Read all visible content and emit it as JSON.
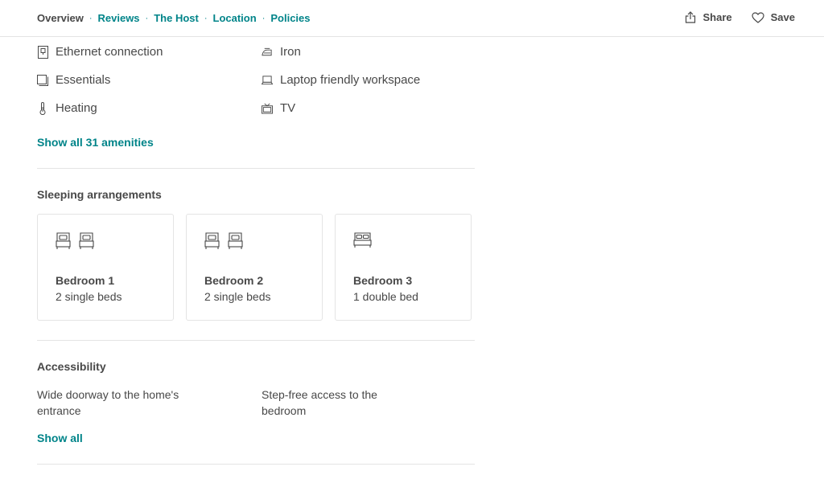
{
  "nav": {
    "items": [
      {
        "label": "Overview",
        "active": true
      },
      {
        "label": "Reviews",
        "active": false
      },
      {
        "label": "The Host",
        "active": false
      },
      {
        "label": "Location",
        "active": false
      },
      {
        "label": "Policies",
        "active": false
      }
    ],
    "separator": "·"
  },
  "actions": {
    "share_label": "Share",
    "save_label": "Save"
  },
  "amenities": {
    "items": [
      {
        "label": "Ethernet connection",
        "icon": "ethernet-icon"
      },
      {
        "label": "Iron",
        "icon": "iron-icon"
      },
      {
        "label": "Essentials",
        "icon": "essentials-icon"
      },
      {
        "label": "Laptop friendly workspace",
        "icon": "laptop-icon"
      },
      {
        "label": "Heating",
        "icon": "thermometer-icon"
      },
      {
        "label": "TV",
        "icon": "tv-icon"
      }
    ],
    "show_all_label": "Show all 31 amenities"
  },
  "sleeping": {
    "title": "Sleeping arrangements",
    "rooms": [
      {
        "name": "Bedroom 1",
        "beds": "2 single beds",
        "icon": "single-bed-icon"
      },
      {
        "name": "Bedroom 2",
        "beds": "2 single beds",
        "icon": "single-bed-icon"
      },
      {
        "name": "Bedroom 3",
        "beds": "1 double bed",
        "icon": "double-bed-icon"
      }
    ]
  },
  "accessibility": {
    "title": "Accessibility",
    "items": [
      "Wide doorway to the home's entrance",
      "Step-free access to the bedroom"
    ],
    "show_all_label": "Show all"
  },
  "colors": {
    "accent": "#008489",
    "text": "#484848",
    "divider": "#e4e4e4"
  }
}
